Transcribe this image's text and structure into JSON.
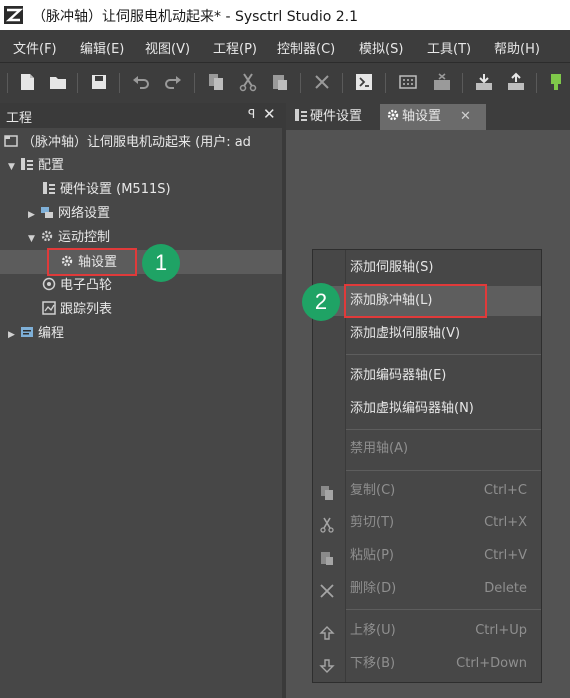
{
  "window": {
    "title": "（脉冲轴）让伺服电机动起来* - Sysctrl Studio 2.1"
  },
  "menu": [
    "文件(F)",
    "编辑(E)",
    "视图(V)",
    "工程(P)",
    "控制器(C)",
    "模拟(S)",
    "工具(T)",
    "帮助(H)"
  ],
  "project_pane": {
    "title": "工程",
    "pin": "ꟼ",
    "close": "✕",
    "tree": {
      "root": "（脉冲轴）让伺服电机动起来 (用户: ad",
      "config": "配置",
      "hardware": "硬件设置 (M511S)",
      "network": "网络设置",
      "motion": "运动控制",
      "axis": "轴设置",
      "cam": "电子凸轮",
      "trace": "跟踪列表",
      "program": "编程"
    }
  },
  "tabs": [
    {
      "label": "硬件设置",
      "active": false
    },
    {
      "label": "轴设置",
      "active": true,
      "close": "✕"
    }
  ],
  "context_menu": {
    "items": [
      {
        "label": "添加伺服轴(S)",
        "shortcut": "",
        "enabled": true
      },
      {
        "label": "添加脉冲轴(L)",
        "shortcut": "",
        "enabled": true,
        "highlighted": true
      },
      {
        "label": "添加虚拟伺服轴(V)",
        "shortcut": "",
        "enabled": true
      },
      {
        "label": "添加编码器轴(E)",
        "shortcut": "",
        "enabled": true
      },
      {
        "label": "添加虚拟编码器轴(N)",
        "shortcut": "",
        "enabled": true
      },
      {
        "label": "禁用轴(A)",
        "shortcut": "",
        "enabled": false
      },
      {
        "label": "复制(C)",
        "shortcut": "Ctrl+C",
        "enabled": false
      },
      {
        "label": "剪切(T)",
        "shortcut": "Ctrl+X",
        "enabled": false
      },
      {
        "label": "粘贴(P)",
        "shortcut": "Ctrl+V",
        "enabled": false
      },
      {
        "label": "删除(D)",
        "shortcut": "Delete",
        "enabled": false
      },
      {
        "label": "上移(U)",
        "shortcut": "Ctrl+Up",
        "enabled": false
      },
      {
        "label": "下移(B)",
        "shortcut": "Ctrl+Down",
        "enabled": false
      }
    ]
  },
  "callouts": [
    {
      "number": "1"
    },
    {
      "number": "2"
    }
  ],
  "colors": {
    "accent_badge": "#1fa365",
    "highlight_box": "#e03a3a",
    "background": "#535353"
  }
}
